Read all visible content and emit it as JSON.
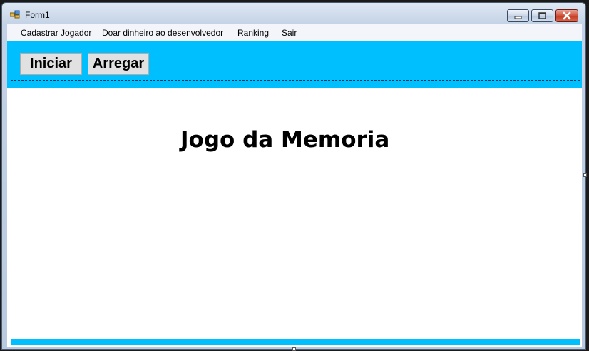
{
  "window": {
    "title": "Form1",
    "icon": "winforms-app-icon",
    "controls": [
      "minimize-icon",
      "maximize-icon",
      "close-icon"
    ]
  },
  "menu": {
    "items": [
      {
        "label": "Cadastrar Jogador"
      },
      {
        "label": "Doar dinheiro ao desenvolvedor"
      },
      {
        "label": "Ranking"
      },
      {
        "label": "Sair"
      }
    ]
  },
  "toolbar": {
    "start_label": "Iniciar",
    "quit_label": "Arregar"
  },
  "main": {
    "title": "Jogo da Memoria"
  },
  "colors": {
    "accent": "#00bfff",
    "background": "#ffffff",
    "button": "#e1e1e1"
  }
}
